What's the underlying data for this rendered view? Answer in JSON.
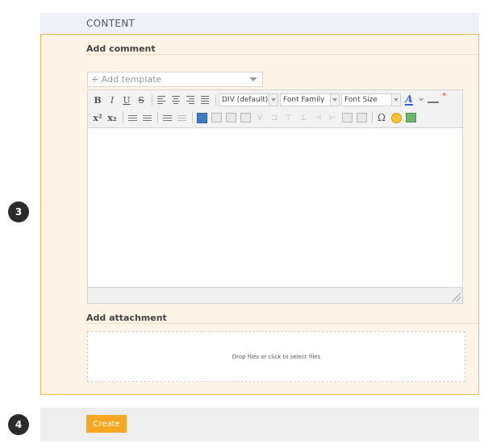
{
  "steps": {
    "step3": "3",
    "step4": "4"
  },
  "content_header": "CONTENT",
  "comment": {
    "title": "Add comment",
    "template_placeholder": "+ Add template",
    "toolbar": {
      "bold": "B",
      "italic": "I",
      "underline": "U",
      "strikethrough": "S",
      "format_select": "DIV (default)",
      "font_family_select": "Font Family",
      "font_size_select": "Font Size",
      "text_color": "A",
      "superscript": "x²",
      "subscript": "x₂",
      "special_char": "Ω",
      "required_mark": "*"
    }
  },
  "attachment": {
    "title": "Add attachment",
    "dropzone_text": "Drop files or click to select files"
  },
  "actions": {
    "create_label": "Create"
  },
  "colors": {
    "panel_bg": "#fdf3e7",
    "panel_border": "#f0b54c",
    "header_bg": "#eef1f7",
    "create_button": "#f5a623",
    "step_badge": "#2b2b2b"
  }
}
